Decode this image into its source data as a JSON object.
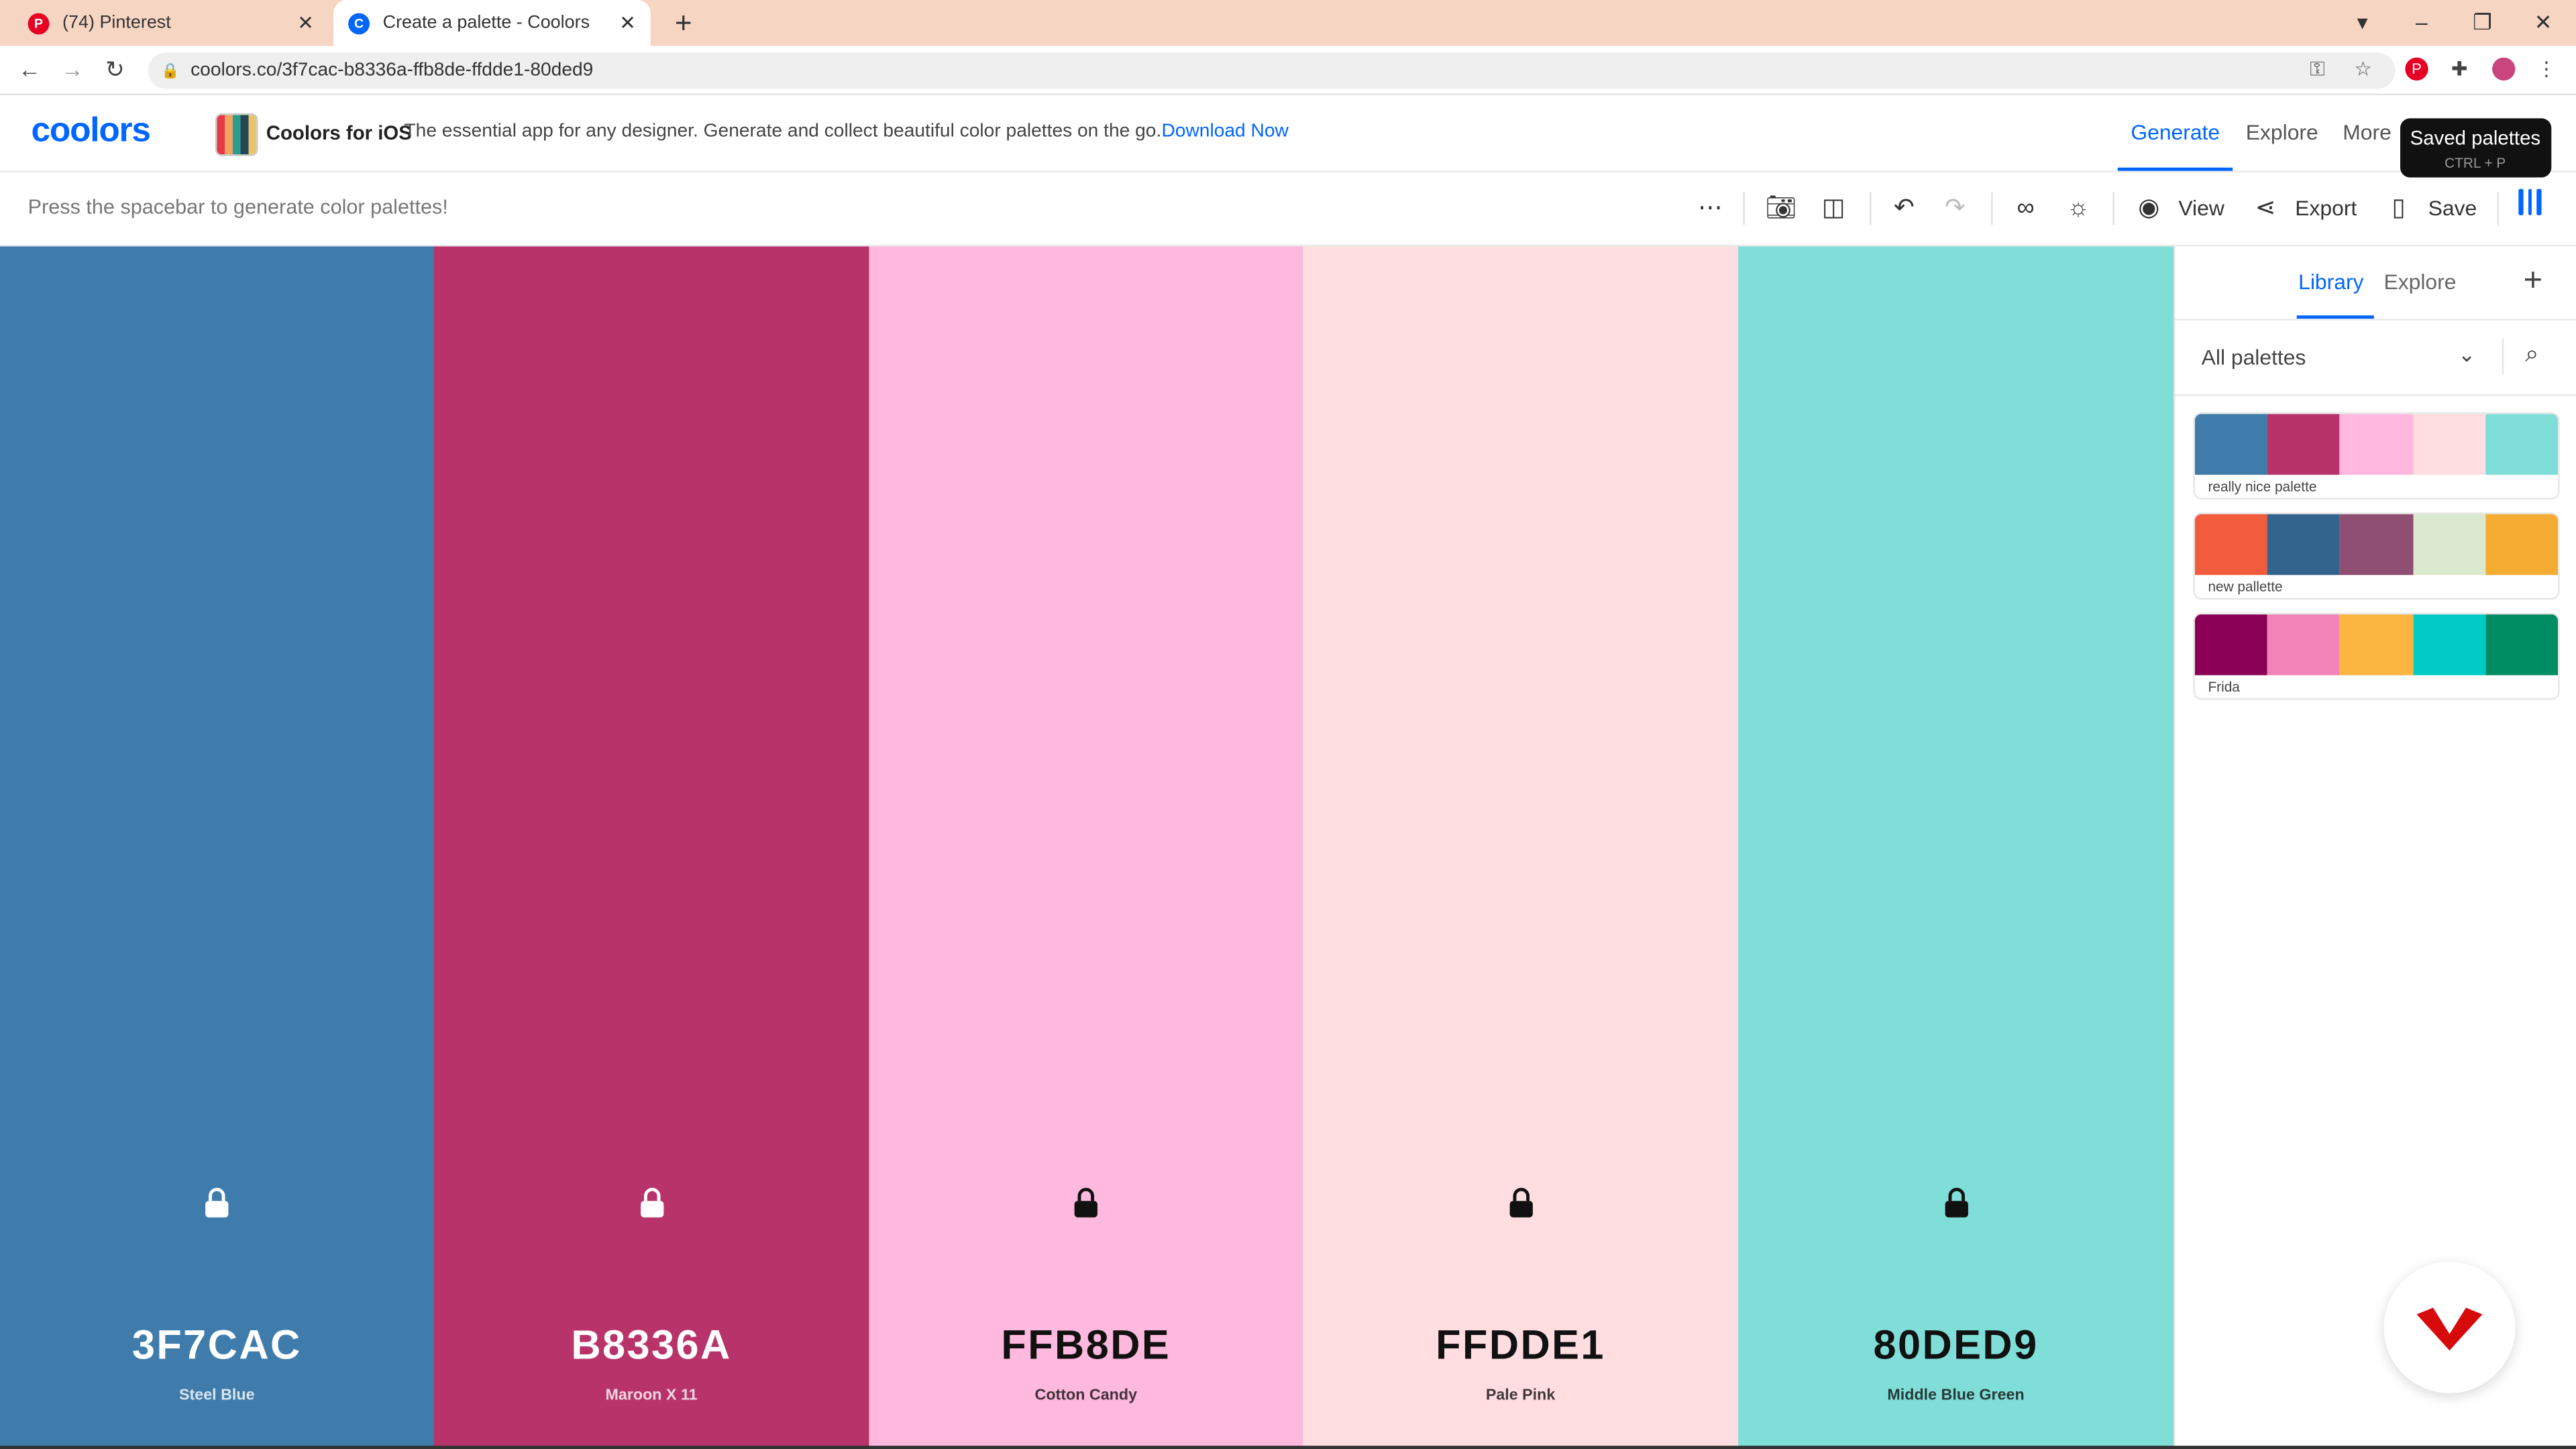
{
  "browser": {
    "tabs": [
      {
        "title": "(74) Pinterest",
        "favicon": "pinterest-icon"
      },
      {
        "title": "Create a palette - Coolors",
        "favicon": "coolors-icon"
      }
    ],
    "url": "coolors.co/3f7cac-b8336a-ffb8de-ffdde1-80ded9"
  },
  "header": {
    "logo": "coolors",
    "promo_title": "Coolors for iOS",
    "promo_text": "The essential app for any designer. Generate and collect beautiful color palettes on the go.",
    "promo_link": "Download Now",
    "nav": [
      "Generate",
      "Explore",
      "More"
    ],
    "tooltip_title": "Saved palettes",
    "tooltip_shortcut": "CTRL + P"
  },
  "toolbar": {
    "hint": "Press the spacebar to generate color palettes!",
    "view_label": "View",
    "export_label": "Export",
    "save_label": "Save"
  },
  "colors": [
    {
      "hex": "3F7CAC",
      "name": "Steel Blue",
      "bg": "#3f7cac",
      "fg": "#ffffff"
    },
    {
      "hex": "B8336A",
      "name": "Maroon X 11",
      "bg": "#b8336a",
      "fg": "#ffffff"
    },
    {
      "hex": "FFB8DE",
      "name": "Cotton Candy",
      "bg": "#ffb8de",
      "fg": "#111111"
    },
    {
      "hex": "FFDDE1",
      "name": "Pale Pink",
      "bg": "#ffdde1",
      "fg": "#111111"
    },
    {
      "hex": "80DED9",
      "name": "Middle Blue Green",
      "bg": "#80ded9",
      "fg": "#111111"
    }
  ],
  "sidebar": {
    "tabs": [
      "Library",
      "Explore"
    ],
    "filter": "All palettes",
    "palettes": [
      {
        "name": "really nice palette",
        "colors": [
          "#3f7cac",
          "#b8336a",
          "#ffb8de",
          "#ffdde1",
          "#80ded9"
        ]
      },
      {
        "name": "new pallette",
        "colors": [
          "#f25c3d",
          "#33648d",
          "#8e4f73",
          "#dbe9cf",
          "#f4ac32"
        ]
      },
      {
        "name": "Frida",
        "colors": [
          "#8a0157",
          "#f283b6",
          "#fbb541",
          "#00cbc4",
          "#008c62"
        ]
      }
    ]
  }
}
